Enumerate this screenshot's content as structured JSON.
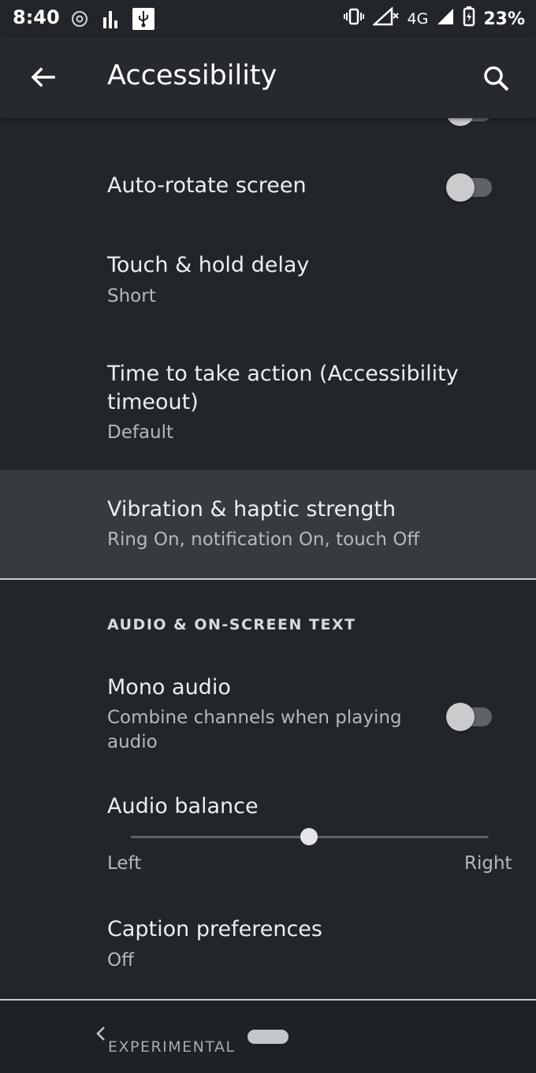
{
  "status_bar": {
    "time": "8:40",
    "network": "4G",
    "battery": "23%"
  },
  "app_bar": {
    "title": "Accessibility"
  },
  "settings": {
    "auto_rotate": {
      "title": "Auto-rotate screen",
      "enabled": false
    },
    "touch_hold": {
      "title": "Touch & hold delay",
      "summary": "Short"
    },
    "timeout": {
      "title_line1": "Time to take action (Accessibility",
      "title_line2": "timeout)",
      "summary": "Default"
    },
    "vibration": {
      "title": "Vibration & haptic strength",
      "summary": "Ring On, notification On, touch Off"
    }
  },
  "audio_section": {
    "header": "AUDIO & ON-SCREEN TEXT",
    "mono_audio": {
      "title": "Mono audio",
      "summary_line1": "Combine channels when playing",
      "summary_line2": "audio",
      "enabled": false
    },
    "audio_balance": {
      "title": "Audio balance",
      "left_label": "Left",
      "right_label": "Right",
      "value": 0.5
    },
    "captions": {
      "title": "Caption preferences",
      "summary": "Off"
    }
  },
  "nav_bar": {
    "label": "EXPERIMENTAL"
  },
  "colors": {
    "background": "#22262b",
    "highlight": "#373a3f",
    "text_primary": "#eceff1",
    "text_secondary": "#b5b9be"
  }
}
